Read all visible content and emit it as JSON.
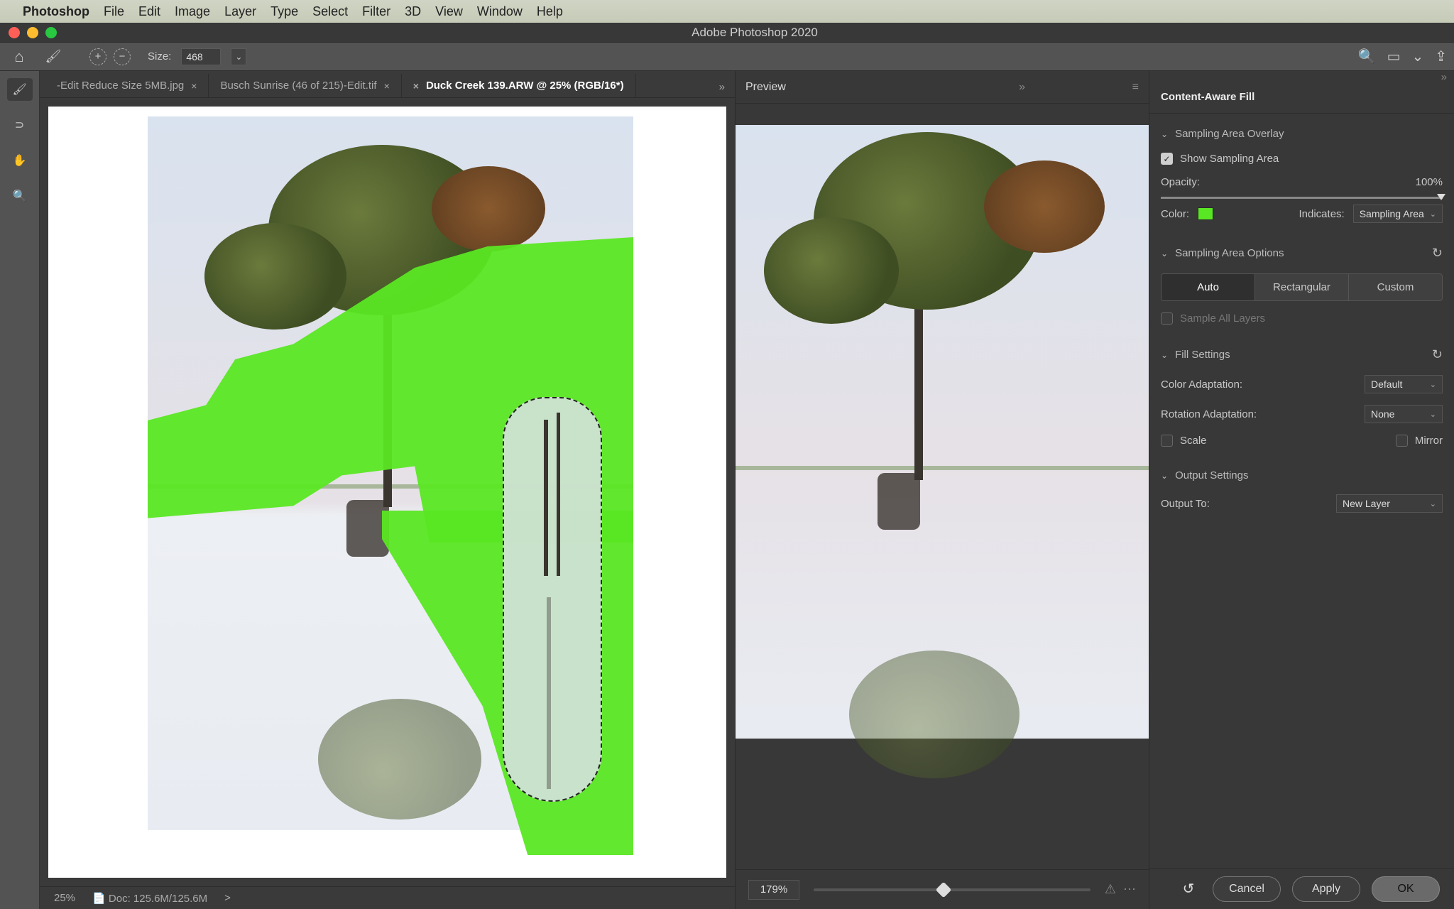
{
  "menubar": {
    "apple": "",
    "app": "Photoshop",
    "items": [
      "File",
      "Edit",
      "Image",
      "Layer",
      "Type",
      "Select",
      "Filter",
      "3D",
      "View",
      "Window",
      "Help"
    ]
  },
  "window": {
    "title": "Adobe Photoshop 2020"
  },
  "options": {
    "size_label": "Size:",
    "size_value": "468",
    "right_icons": [
      "search-icon",
      "screenmode-icon",
      "share-icon"
    ]
  },
  "tools": [
    "brush-tool",
    "lasso-tool",
    "hand-tool",
    "zoom-tool"
  ],
  "tabs": [
    {
      "label": "-Edit Reduce Size 5MB.jpg",
      "active": false
    },
    {
      "label": "Busch Sunrise (46 of 215)-Edit.tif",
      "active": false
    },
    {
      "label": "Duck Creek 139.ARW @ 25% (RGB/16*)",
      "active": true
    }
  ],
  "status": {
    "zoom": "25%",
    "doc": "Doc: 125.6M/125.6M",
    "arrow": ">"
  },
  "preview": {
    "title": "Preview",
    "zoom": "179%",
    "slider_pos": 0.45
  },
  "caf": {
    "title": "Content-Aware Fill",
    "sampling_overlay": {
      "header": "Sampling Area Overlay",
      "show_label": "Show Sampling Area",
      "show_checked": true,
      "opacity_label": "Opacity:",
      "opacity_value": "100%",
      "color_label": "Color:",
      "indicates_label": "Indicates:",
      "indicates_value": "Sampling Area"
    },
    "sampling_options": {
      "header": "Sampling Area Options",
      "modes": [
        "Auto",
        "Rectangular",
        "Custom"
      ],
      "mode_selected": 0,
      "sample_all_label": "Sample All Layers",
      "sample_all_checked": false
    },
    "fill": {
      "header": "Fill Settings",
      "color_adapt_label": "Color Adaptation:",
      "color_adapt_value": "Default",
      "rotation_label": "Rotation Adaptation:",
      "rotation_value": "None",
      "scale_label": "Scale",
      "scale_checked": false,
      "mirror_label": "Mirror",
      "mirror_checked": false
    },
    "output": {
      "header": "Output Settings",
      "output_to_label": "Output To:",
      "output_to_value": "New Layer"
    }
  },
  "footer": {
    "undo": "↺",
    "cancel": "Cancel",
    "apply": "Apply",
    "ok": "OK"
  }
}
